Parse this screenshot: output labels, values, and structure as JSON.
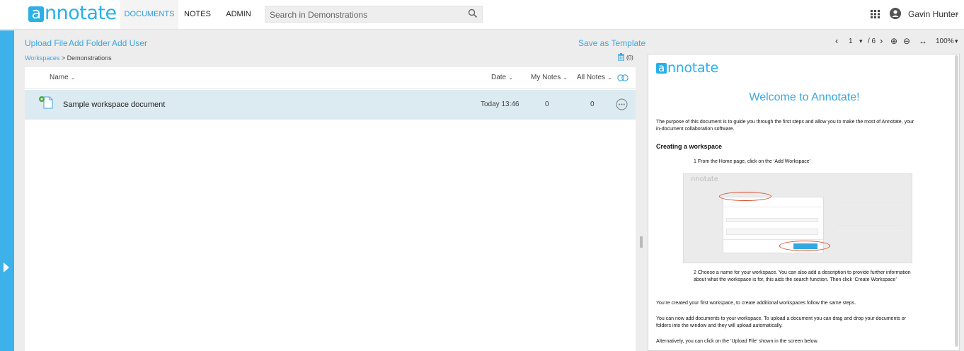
{
  "app": {
    "logo_letter": "a",
    "logo_rest": "nnotate"
  },
  "nav": {
    "documents": "DOCUMENTS",
    "notes": "NOTES",
    "admin": "ADMIN"
  },
  "search": {
    "placeholder": "Search in Demonstrations"
  },
  "user": {
    "name": "Gavin Hunter",
    "caret": "⌄"
  },
  "actions": {
    "upload_file": "Upload File",
    "add_folder": "Add Folder",
    "add_user": "Add User",
    "save_template": "Save as Template"
  },
  "breadcrumb": {
    "root": "Workspaces",
    "sep": " > ",
    "current": "Demonstrations"
  },
  "trash": {
    "count": "(0)"
  },
  "list": {
    "columns": {
      "name": "Name",
      "date": "Date",
      "my_notes": "My Notes",
      "all_notes": "All Notes",
      "caret": "⌄"
    },
    "rows": [
      {
        "title": "Sample workspace document",
        "date": "Today 13:46",
        "my_notes": "0",
        "all_notes": "0"
      }
    ]
  },
  "viewer": {
    "prev": "‹",
    "page": "1",
    "page_caret": "▾",
    "total": "/ 6",
    "next": "›",
    "zoom_in": "⊕",
    "zoom_out": "⊖",
    "fit_width": "↔",
    "zoom": "100%",
    "zoom_caret": "▾"
  },
  "document": {
    "logo_letter": "a",
    "logo_rest": "nnotate",
    "title": "Welcome to Annotate!",
    "intro": "The purpose of this document is to guide you through the first steps and allow you to make the most of Annotate, your in-document collaboration software.",
    "section": "Creating a workspace",
    "step1": "1   From the Home page, click on the ‘Add Workspace’",
    "step2": "2   Choose a name for your workspace. You can also add a description to provide further information about what the workspace is for, this aids the search function. Then click ‘Create Workspace’",
    "para2": "You’re created your first workspace, to create additional workspaces follow the same steps.",
    "para3": "You can now add documents to your workspace. To upload a document you can drag and drop your documents or folders into the window and they will upload automatically.",
    "para4": "Alternatively, you can click on the ‘Upload File’ shown in the screen below."
  },
  "colors": {
    "accent": "#2bb0e6",
    "row_selected": "#dcebf2",
    "left_strip": "#3cb1ea",
    "highlight_oval": "#d9482b"
  },
  "icons": [
    "search-icon",
    "grid-icon",
    "user-icon",
    "trash-icon",
    "document-icon",
    "toggle-icon",
    "more-icon",
    "expand-arrow-icon",
    "zoom-in-icon",
    "zoom-out-icon",
    "fit-width-icon"
  ]
}
